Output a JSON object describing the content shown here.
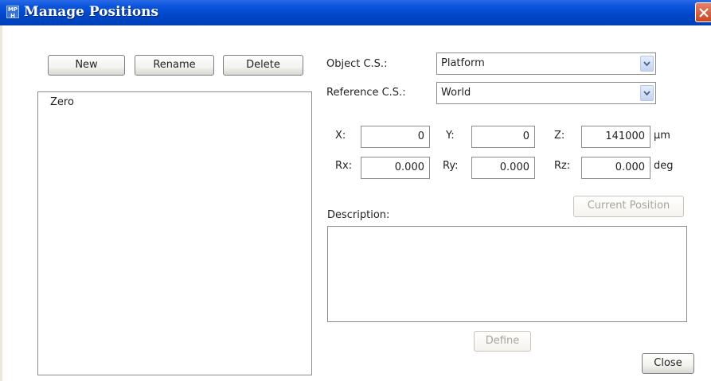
{
  "window": {
    "title": "Manage Positions",
    "app_icon_text": "MP H"
  },
  "toolbar": {
    "new_label": "New",
    "rename_label": "Rename",
    "delete_label": "Delete"
  },
  "positions": {
    "items": [
      "Zero"
    ]
  },
  "object_cs": {
    "label": "Object C.S.:",
    "value": "Platform"
  },
  "reference_cs": {
    "label": "Reference C.S.:",
    "value": "World"
  },
  "coords": {
    "x": {
      "label": "X:",
      "value": "0"
    },
    "y": {
      "label": "Y:",
      "value": "0"
    },
    "z": {
      "label": "Z:",
      "value": "141000"
    },
    "linear_unit": "µm",
    "rx": {
      "label": "Rx:",
      "value": "0.000"
    },
    "ry": {
      "label": "Ry:",
      "value": "0.000"
    },
    "rz": {
      "label": "Rz:",
      "value": "0.000"
    },
    "angular_unit": "deg"
  },
  "current_position_label": "Current Position",
  "description": {
    "label": "Description:",
    "value": ""
  },
  "define_label": "Define",
  "close_label": "Close",
  "icons": {
    "title": "app-icon",
    "close": "close-icon",
    "dropdown": "chevron-down-icon"
  }
}
